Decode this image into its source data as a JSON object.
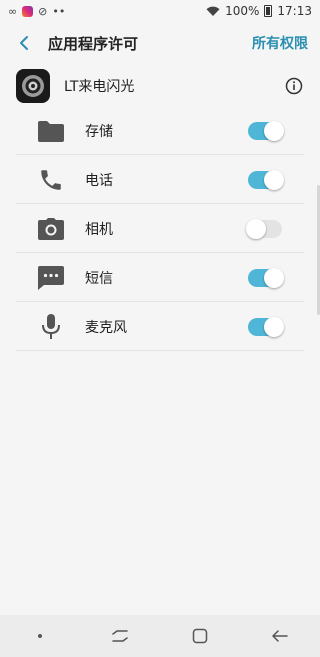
{
  "status_bar": {
    "battery": "100%",
    "time": "17:13"
  },
  "header": {
    "title": "应用程序许可",
    "all_permissions": "所有权限"
  },
  "app": {
    "name": "LT来电闪光"
  },
  "permissions": [
    {
      "label": "存储",
      "icon": "folder-icon",
      "enabled": true
    },
    {
      "label": "电话",
      "icon": "phone-icon",
      "enabled": true
    },
    {
      "label": "相机",
      "icon": "camera-icon",
      "enabled": false
    },
    {
      "label": "短信",
      "icon": "sms-icon",
      "enabled": true
    },
    {
      "label": "麦克风",
      "icon": "microphone-icon",
      "enabled": true
    }
  ],
  "colors": {
    "accent": "#2a8fb0",
    "toggle_on": "#4fb6d8",
    "toggle_off": "#e3e3e3"
  }
}
